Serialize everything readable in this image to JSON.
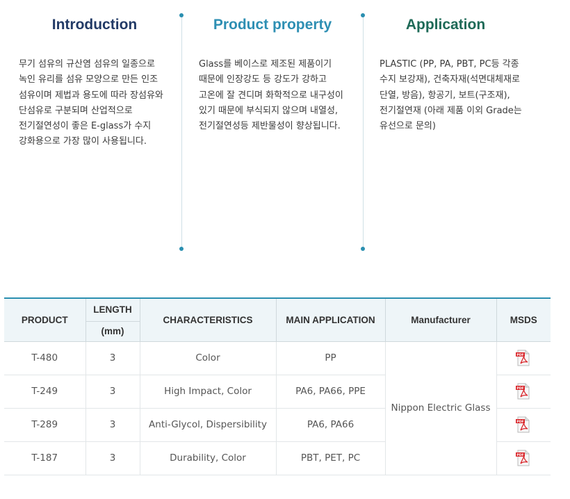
{
  "columns": {
    "introduction": {
      "title": "Introduction",
      "body": "무기 섬유의 규산염 섬유의 일종으로 녹인 유리를 섬유 모양으로 만든 인조 섬유이며 제법과 용도에 따라 장섬유와 단섬유로 구분되며 산업적으로 전기절연성이 좋은 E-glass가 수지 강화용으로 가장 많이 사용됩니다."
    },
    "product_property": {
      "title": "Product property",
      "body": "Glass를 베이스로 제조된 제품이기 때문에 인장강도 등 강도가 강하고 고온에 잘 견디며 화학적으로 내구성이 있기 때문에 부식되지 않으며 내열성, 전기절연성등 제반물성이 향상됩니다."
    },
    "application": {
      "title": "Application",
      "body": "PLASTIC (PP, PA, PBT, PC등 각종 수지 보강재), 건축자재(석면대체재로 단열, 방음), 항공기, 보트(구조재), 전기절연재 (아래 제품 이외 Grade는 유선으로 문의)"
    }
  },
  "table": {
    "headers": {
      "product": "PRODUCT",
      "length": "LENGTH",
      "length_unit": "(mm)",
      "characteristics": "CHARACTERISTICS",
      "main_application": "MAIN APPLICATION",
      "manufacturer": "Manufacturer",
      "msds": "MSDS"
    },
    "manufacturer": "Nippon Electric Glass",
    "rows": [
      {
        "product": "T-480",
        "length": "3",
        "characteristics": "Color",
        "main_application": "PP"
      },
      {
        "product": "T-249",
        "length": "3",
        "characteristics": "High Impact, Color",
        "main_application": "PA6, PA66, PPE"
      },
      {
        "product": "T-289",
        "length": "3",
        "characteristics": "Anti-Glycol, Dispersibility",
        "main_application": "PA6, PA66"
      },
      {
        "product": "T-187",
        "length": "3",
        "characteristics": "Durability, Color",
        "main_application": "PBT, PET, PC"
      }
    ],
    "msds_icon": "pdf-file-icon",
    "accent_color": "#2a8fb0"
  }
}
